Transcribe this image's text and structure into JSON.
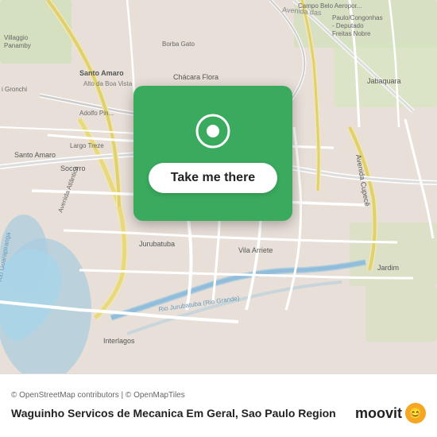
{
  "map": {
    "attribution": "© OpenStreetMap contributors | © OpenMapTiles",
    "center_lat": -23.65,
    "center_lng": -46.72
  },
  "location_card": {
    "button_label": "Take me there"
  },
  "bottom_bar": {
    "place_name": "Waguinho Servicos de Mecanica Em Geral, Sao Paulo Region",
    "attribution": "© OpenStreetMap contributors | © OpenMapTiles"
  },
  "moovit": {
    "label": "moovit",
    "emoji": "😊"
  },
  "streets": [
    {
      "label": "Avenida das"
    },
    {
      "label": "Santo Amaro"
    },
    {
      "label": "Chácara Flora"
    },
    {
      "label": "Avenida Atlântica"
    },
    {
      "label": "Avenida Cupecê"
    },
    {
      "label": "Rio Jurubatuba (Rio Grande)"
    },
    {
      "label": "Interlagos"
    },
    {
      "label": "Jurubatuba"
    },
    {
      "label": "Vila Arriete"
    },
    {
      "label": "Socorro"
    },
    {
      "label": "Largo Treze"
    },
    {
      "label": "Adolfo Pin"
    },
    {
      "label": "Alto da Boa Vista"
    },
    {
      "label": "Jabaquara"
    },
    {
      "label": "Jardim"
    },
    {
      "label": "Villaggio Panamby"
    },
    {
      "label": "i Gronchi"
    },
    {
      "label": "Rio Guarapiranga"
    },
    {
      "label": "Borba Gato"
    },
    {
      "label": "Campo Belo Aeropor"
    },
    {
      "label": "Paulo/Congonhas - Deputado Freitas Nobre"
    }
  ]
}
